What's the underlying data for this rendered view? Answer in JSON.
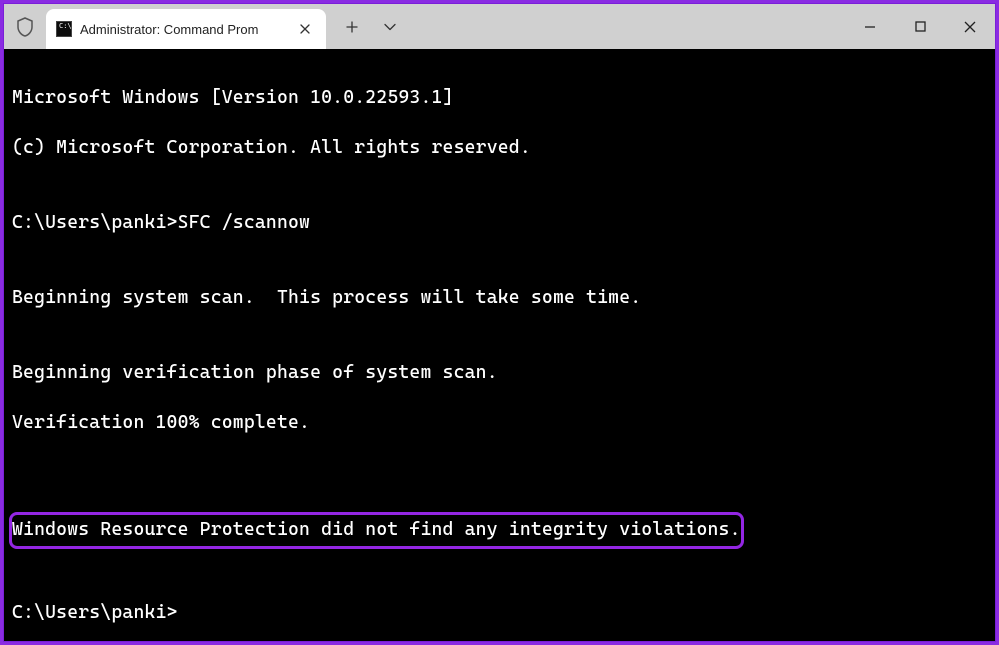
{
  "tab": {
    "title": "Administrator: Command Prom"
  },
  "terminal": {
    "line1": "Microsoft Windows [Version 10.0.22593.1]",
    "line2": "(c) Microsoft Corporation. All rights reserved.",
    "blank1": "",
    "line3": "C:\\Users\\panki>SFC /scannow",
    "blank2": "",
    "line4": "Beginning system scan.  This process will take some time.",
    "blank3": "",
    "line5": "Beginning verification phase of system scan.",
    "line6": "Verification 100% complete.",
    "blank4": "",
    "highlight": "Windows Resource Protection did not find any integrity violations.",
    "blank5": "",
    "line7": "C:\\Users\\panki>"
  }
}
